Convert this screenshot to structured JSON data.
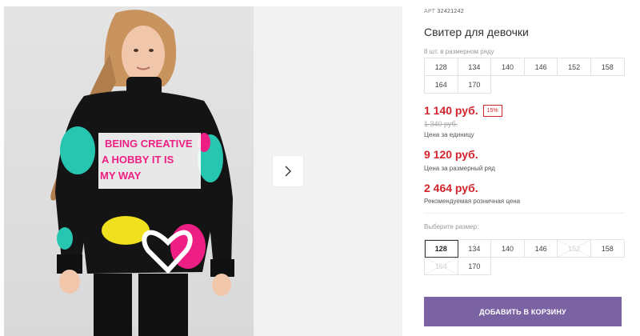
{
  "product": {
    "art_label": "АРТ",
    "art_number": "32421242",
    "title": "Свитер для девочки",
    "pack_info": "8 шт. в размерном ряду"
  },
  "pack_sizes": [
    "128",
    "134",
    "140",
    "146",
    "152",
    "158",
    "164",
    "170"
  ],
  "prices": {
    "unit_price": "1 140 руб.",
    "discount": "15%",
    "old_price": "1 340 руб.",
    "unit_label": "Цена за единицу",
    "pack_price": "9 120 руб.",
    "pack_label": "Цена за размерный ряд",
    "rrp_price": "2 464 руб.",
    "rrp_label": "Рекомендуемая розничная цена"
  },
  "size_select": {
    "label": "Выберите размер:",
    "options": [
      {
        "label": "128",
        "available": true,
        "selected": true
      },
      {
        "label": "134",
        "available": true,
        "selected": false
      },
      {
        "label": "140",
        "available": true,
        "selected": false
      },
      {
        "label": "146",
        "available": true,
        "selected": false
      },
      {
        "label": "152",
        "available": false,
        "selected": false
      },
      {
        "label": "158",
        "available": true,
        "selected": false
      },
      {
        "label": "164",
        "available": false,
        "selected": false
      },
      {
        "label": "170",
        "available": true,
        "selected": false
      }
    ]
  },
  "cart_button": {
    "label": "ДОБАВИТЬ В КОРЗИНУ",
    "color": "#7b62a3"
  },
  "gallery": {
    "next_icon": "chevron-right-icon",
    "sweater_text": [
      "BEING CREATIVE",
      "A HOBBY IT IS",
      "MY WAY"
    ]
  },
  "colors": {
    "price_red": "#d3242c",
    "accent_purple": "#7b62a3"
  }
}
